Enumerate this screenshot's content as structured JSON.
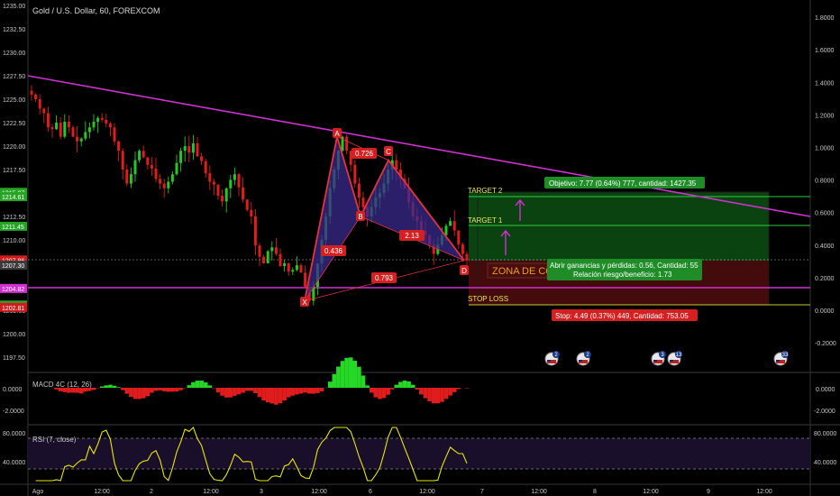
{
  "title": "Gold / U.S. Dollar, 60, FOREXCOM",
  "colors": {
    "background": "#000000",
    "up": "#26c826",
    "down": "#e01c1c",
    "pattern_line": "#e8323c",
    "pattern_fill": "#3a2a8c",
    "trendline": "#d030d0",
    "target_zone": "#0c4a12",
    "stop_zone": "#4a0c0c",
    "grid_text": "#c8c8c8",
    "target_line": "#2ecc40",
    "stop_line": "#c8c832",
    "macd_pos": "#26d826",
    "macd_neg": "#e01c1c",
    "rsi_line": "#e8e800",
    "rsi_band": "#2a1840"
  },
  "main_axis_left": {
    "ticks": [
      "1235.00",
      "1232.50",
      "1230.00",
      "1227.50",
      "1225.00",
      "1222.50",
      "1220.00",
      "1217.50",
      "1215.00",
      "1212.50",
      "1210.00",
      "1207.50",
      "1205.00",
      "1202.50",
      "1200.00",
      "1197.50"
    ],
    "price_tags": [
      {
        "text": "1215.07",
        "color": "#26a426"
      },
      {
        "text": "1214.61",
        "color": "#26a426"
      },
      {
        "text": "1211.45",
        "color": "#26a426"
      },
      {
        "text": "1207.86",
        "color": "#d01c1c"
      },
      {
        "text": "1207.30",
        "color": "#3a3a3a"
      },
      {
        "text": "1204.82",
        "color": "#d030d0"
      },
      {
        "text": "1203.05",
        "color": "#26a426"
      },
      {
        "text": "1202.81",
        "color": "#d01c1c"
      }
    ]
  },
  "main_axis_right": {
    "ticks": [
      "1.8000",
      "1.6000",
      "1.4000",
      "1.2000",
      "1.0000",
      "0.8000",
      "0.6000",
      "0.4000",
      "0.2000",
      "0.0000",
      "-0.2000"
    ]
  },
  "x_axis": {
    "labels": [
      "Ago",
      "12:00",
      "2",
      "12:00",
      "3",
      "12:00",
      "6",
      "12:00",
      "7",
      "12:00",
      "8",
      "12:00",
      "9",
      "12:00"
    ]
  },
  "pattern": {
    "points": [
      "X",
      "A",
      "B",
      "C",
      "D"
    ],
    "ratios": [
      "0.726",
      "0.436",
      "2.13",
      "0.793"
    ]
  },
  "annotations": {
    "target2": "TARGET 2",
    "target1": "TARGET 1",
    "stop_loss": "STOP LOSS",
    "zone": "ZONA DE CO",
    "objective_box": "Objetivo: 7.77 (0.64%) 777, cantidad: 1427.35",
    "pnl_line1": "Abrir ganancias y pérdidas: 0.56, Cantidad: 55",
    "pnl_line2": "Relación riesgo/beneficio: 1.73",
    "stop_box": "Stop: 4.49 (0.37%) 449, Cantidad: 753.05"
  },
  "events": [
    "2",
    "2",
    "3",
    "13",
    "33"
  ],
  "macd": {
    "label": "MACD 4C (12, 26)",
    "ticks": [
      "0.0000",
      "-2.0000"
    ]
  },
  "rsi": {
    "label": "RSI (7, close)",
    "ticks": [
      "80.0000",
      "40.0000"
    ]
  },
  "chart_data": {
    "type": "candlestick",
    "title": "Gold / U.S. Dollar, 60, FOREXCOM",
    "ylim": [
      1196,
      1236
    ],
    "candles_close": [
      1225.5,
      1225.0,
      1224.0,
      1223.5,
      1222.0,
      1221.8,
      1222.5,
      1221.0,
      1222.6,
      1222.0,
      1221.0,
      1220.5,
      1220.8,
      1221.5,
      1222.0,
      1222.6,
      1223.0,
      1222.8,
      1222.4,
      1222.0,
      1220.5,
      1219.5,
      1217.5,
      1216.0,
      1217.0,
      1218.5,
      1219.5,
      1218.8,
      1218.0,
      1217.6,
      1216.5,
      1216.0,
      1215.5,
      1216.2,
      1217.0,
      1218.2,
      1219.5,
      1220.0,
      1219.3,
      1220.3,
      1218.9,
      1218.4,
      1217.1,
      1216.2,
      1215.9,
      1214.7,
      1214.1,
      1215.5,
      1216.4,
      1217.0,
      1215.6,
      1214.3,
      1213.2,
      1212.5,
      1209.4,
      1208.2,
      1207.5,
      1208.8,
      1209.2,
      1208.5,
      1207.2,
      1207.5,
      1206.6,
      1206.8,
      1207.3,
      1206.5,
      1205.0,
      1203.5,
      1205.0,
      1207.5,
      1210.0,
      1212.5,
      1215.5,
      1217.5,
      1219.5,
      1221.0,
      1219.5,
      1218.0,
      1216.0,
      1214.5,
      1213.5,
      1212.5,
      1213.5,
      1214.5,
      1215.0,
      1216.0,
      1217.5,
      1218.5,
      1217.5,
      1216.5,
      1215.5,
      1214.0,
      1212.5,
      1212.0,
      1211.0,
      1210.5,
      1209.5,
      1208.5,
      1209.5,
      1210.5,
      1211.5,
      1212.0,
      1211.0,
      1209.5,
      1208.5,
      1207.8
    ],
    "pattern_prices": {
      "X": 1203.5,
      "A": 1221.0,
      "B": 1212.5,
      "C": 1218.5,
      "D": 1207.8
    },
    "target2": 1215.1,
    "target1": 1211.4,
    "entry": 1207.3,
    "stop_loss": 1202.8,
    "trendline": {
      "start": 1228.3,
      "end": 1211.6
    },
    "horizontal_level": 1204.8,
    "rsi_levels": [
      70,
      30
    ]
  }
}
